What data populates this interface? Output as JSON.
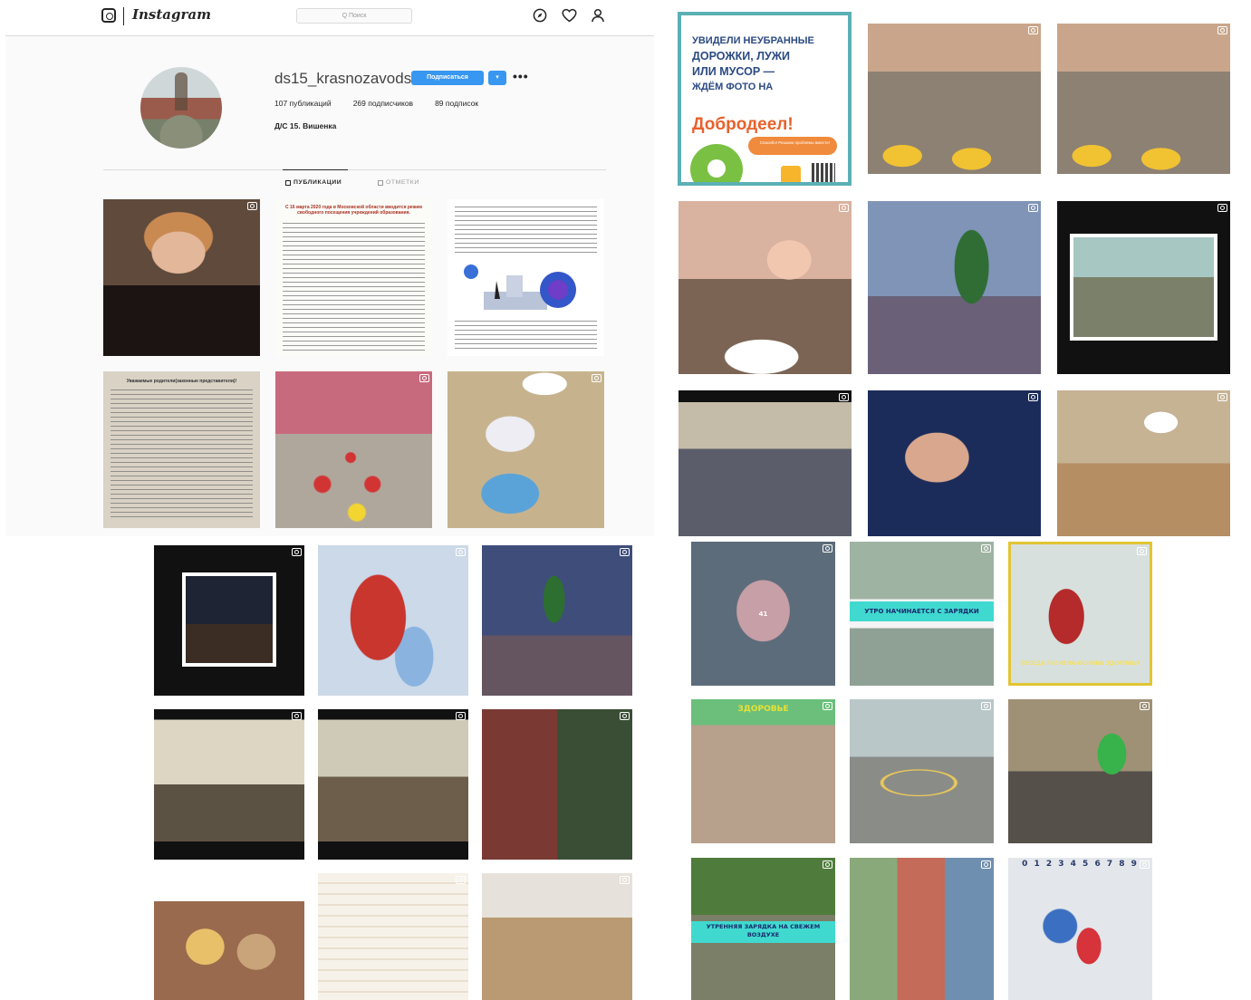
{
  "nav": {
    "wordmark": "Instagram",
    "search_placeholder": "Q Поиск"
  },
  "profile": {
    "username": "ds15_krasnozavodsk",
    "follow_label": "Подписаться",
    "dropdown_label": "▾",
    "more_label": "•••",
    "posts": "107 публикаций",
    "followers": "269 подписчиков",
    "following": "89 подписок",
    "full_name": "Д/С 15. Вишенка"
  },
  "tabs": {
    "posts": "ПУБЛИКАЦИИ",
    "tagged": "ОТМЕТКИ"
  },
  "posts": {
    "doc_title": "С 16 марта 2020 года в Московской области вводится режим свободного посещения учреждений образования.",
    "notice_title": "Уважаемые родители(законные представители)!"
  },
  "eco_poster": {
    "line1": "УВИДЕЛИ НЕУБРАННЫЕ",
    "line2": "ДОРОЖКИ, ЛУЖИ",
    "line3": "ИЛИ МУСОР —",
    "line4": "ЖДЁМ ФОТО НА",
    "brand": "Добродеел!",
    "pill": "Спасибо! Решаем проблемы вместе!"
  },
  "captions": {
    "morning_exercise": "УТРО НАЧИНАЕТСЯ С ЗАРЯДКИ",
    "hygiene": "БЕСЕДА ГИГИЕНА-ОСНОВА ЗДОРОВЬЯ",
    "outdoor_exercise": "УТРЕННЯЯ ЗАРЯДКА НА СВЕЖЕМ ВОЗДУХЕ",
    "health": "ЗДОРОВЬЕ",
    "counter": "41",
    "numbers_strip": "0 1 2 3 4 5 6 7 8 9"
  },
  "colors": {
    "follow_blue": "#3897f0",
    "border": "#dbdbdb",
    "text": "#262626",
    "eco_teal": "#5bb0b5",
    "eco_orange": "#e8612c"
  },
  "icons": {
    "nav": [
      "instagram-glyph-icon",
      "explore-compass-icon",
      "heart-icon",
      "profile-person-icon"
    ],
    "tile_badge": "carousel-badge-icon"
  }
}
